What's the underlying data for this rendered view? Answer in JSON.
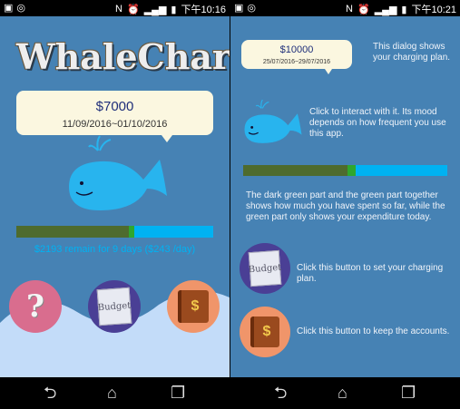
{
  "status_left": {
    "time": "下午10:16"
  },
  "status_right": {
    "time": "下午10:21"
  },
  "app_title": "WhaleCharger",
  "left_plan": {
    "amount": "$7000",
    "dates": "11/09/2016~01/10/2016"
  },
  "left_progress": {
    "dark": 0.57,
    "green": 0.03
  },
  "remain_text": "$2193 remain for 9 days  ($243 /day)",
  "buttons": {
    "help": "?",
    "budget": "Budget",
    "accounts": "$"
  },
  "right_plan": {
    "amount": "$10000",
    "dates": "25/07/2016~29/07/2016"
  },
  "right_progress": {
    "dark": 0.51,
    "green": 0.04
  },
  "tips": {
    "dialog": "This dialog shows your charging plan.",
    "whale": "Click to interact with it. Its mood depends on how frequent you use this app.",
    "bar": "The dark green part and the green part together shows how much you have spent so far, while the green part only shows your expenditure today.",
    "budget_btn": "Click this button to set your charging plan.",
    "accounts_btn": "Click this button to keep the accounts."
  },
  "colors": {
    "panel": "#4682b4",
    "bar_dark": "#4e6b2e",
    "bar_green": "#2fa72e",
    "bar_rest": "#00b2f2",
    "whale": "#28b4ee"
  }
}
